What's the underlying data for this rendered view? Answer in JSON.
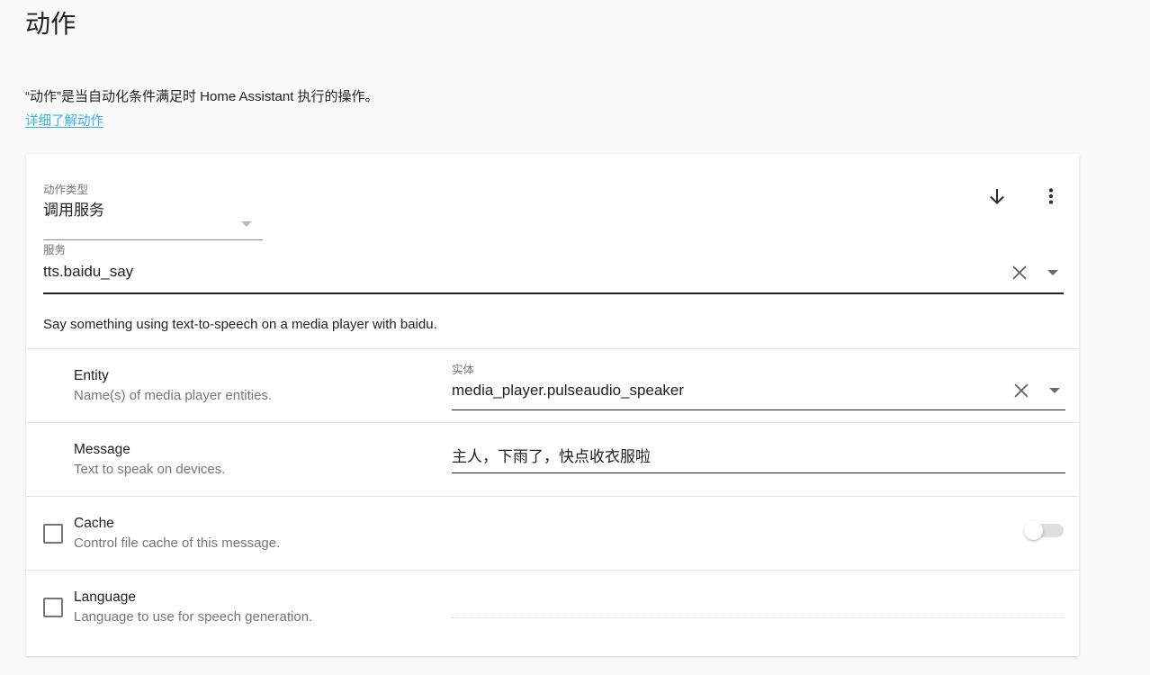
{
  "header": {
    "title": "动作",
    "intro": "“动作”是当自动化条件满足时 Home Assistant 执行的操作。",
    "link_label": "详细了解动作",
    "link_color": "#39b0ed"
  },
  "card": {
    "action_type": {
      "label": "动作类型",
      "value": "调用服务",
      "arrow_icon": "chevron-down-icon"
    },
    "toolbar": {
      "move_down_icon": "arrow-down-icon",
      "overflow_icon": "more-vertical-icon"
    },
    "service": {
      "label": "服务",
      "value": "tts.baidu_say",
      "clear_icon": "close-icon",
      "dropdown_icon": "chevron-down-icon",
      "description": "Say something using text-to-speech on a media player with baidu."
    },
    "rows": [
      {
        "key": "entity",
        "title": "Entity",
        "subtitle": "Name(s) of media player entities.",
        "has_checkbox": false,
        "checked": false,
        "control": "entity-picker",
        "field_label": "实体",
        "value": "media_player.pulseaudio_speaker",
        "clear_icon": "close-icon",
        "dropdown_icon": "chevron-down-icon"
      },
      {
        "key": "message",
        "title": "Message",
        "subtitle": "Text to speak on devices.",
        "has_checkbox": false,
        "checked": false,
        "control": "text-input",
        "field_label": "",
        "value": "主人，下雨了，快点收衣服啦"
      },
      {
        "key": "cache",
        "title": "Cache",
        "subtitle": "Control file cache of this message.",
        "has_checkbox": true,
        "checked": false,
        "control": "toggle",
        "toggle_on": false
      },
      {
        "key": "language",
        "title": "Language",
        "subtitle": "Language to use for speech generation.",
        "has_checkbox": true,
        "checked": false,
        "control": "disabled-input",
        "value": ""
      }
    ]
  },
  "colors": {
    "page_background": "#fafafa",
    "card_background": "#ffffff",
    "primary_text": "#212121",
    "secondary_text": "#757575",
    "divider": "#e4e4e4",
    "underline_active": "#212121",
    "toggle_track_off": "#dedede"
  }
}
